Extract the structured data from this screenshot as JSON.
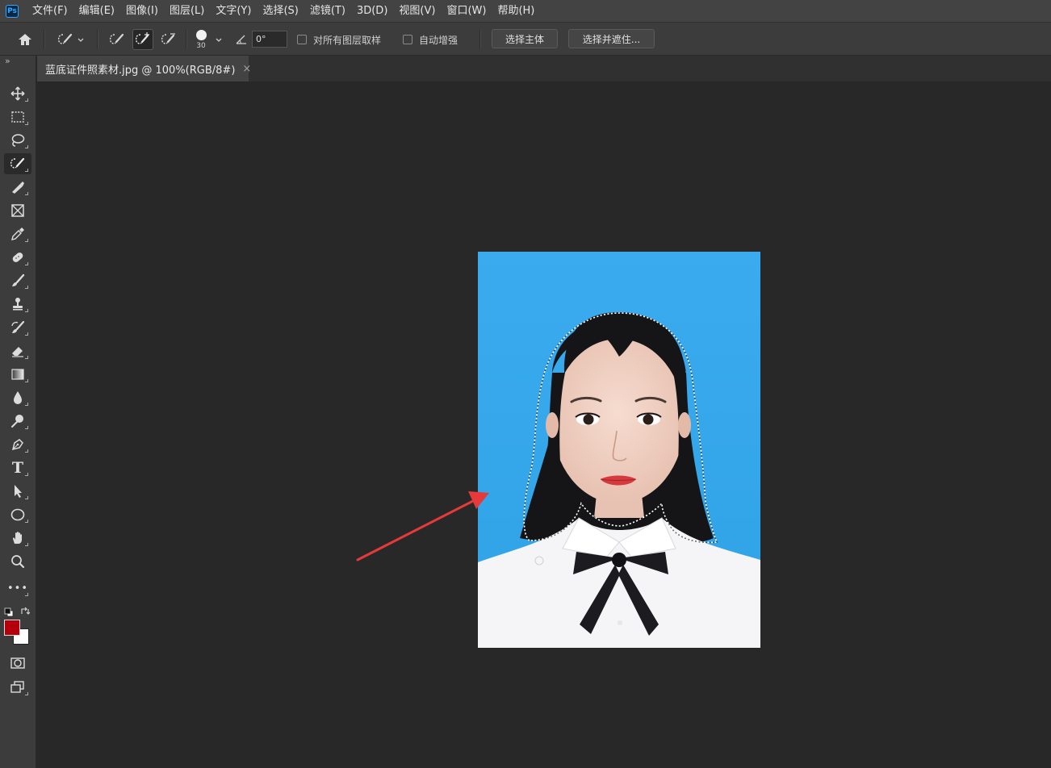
{
  "app": {
    "logo_text": "Ps"
  },
  "menu": [
    "文件(F)",
    "编辑(E)",
    "图像(I)",
    "图层(L)",
    "文字(Y)",
    "选择(S)",
    "滤镜(T)",
    "3D(D)",
    "视图(V)",
    "窗口(W)",
    "帮助(H)"
  ],
  "options": {
    "brush_size": "30",
    "angle_value": "0°",
    "sample_all_layers_label": "对所有图层取样",
    "sample_all_layers_checked": false,
    "auto_enhance_label": "自动增强",
    "auto_enhance_checked": false,
    "select_subject_label": "选择主体",
    "select_and_mask_label": "选择并遮住..."
  },
  "document": {
    "tab_title": "蓝底证件照素材.jpg @ 100%(RGB/8#)",
    "close_glyph": "×"
  },
  "toolbar": {
    "collapse_glyph": "»",
    "tools": [
      "move-icon",
      "marquee-icon",
      "lasso-icon",
      "quick-selection-icon",
      "brush-select-icon",
      "frame-icon",
      "eyedropper-icon",
      "healing-brush-icon",
      "brush-icon",
      "clone-stamp-icon",
      "history-brush-icon",
      "eraser-icon",
      "gradient-icon",
      "blur-icon",
      "dodge-icon",
      "pen-icon",
      "type-icon",
      "path-selection-icon",
      "ellipse-icon",
      "hand-icon",
      "zoom-icon",
      "more-icon"
    ],
    "active_tool": "quick-selection-icon",
    "type_tool_glyph": "T",
    "more_glyph": "•••",
    "foreground_color": "#b3000c",
    "background_color": "#ffffff"
  },
  "colors": {
    "photo_background": "#36a9ec",
    "annotation_arrow": "#e63a3a"
  }
}
